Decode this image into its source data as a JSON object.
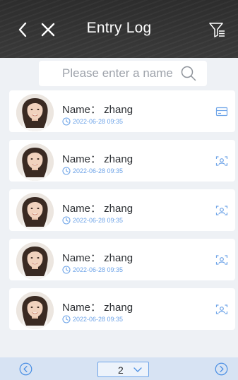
{
  "header": {
    "title": "Entry Log",
    "back_icon": "chevron-left-icon",
    "close_icon": "close-icon",
    "filter_icon": "filter-list-icon"
  },
  "search": {
    "placeholder": "Please enter a name",
    "value": "",
    "icon": "search-icon"
  },
  "entries": [
    {
      "name": "Name： zhang",
      "time": "2022-06-28 09:35",
      "method_icon": "card-icon"
    },
    {
      "name": "Name： zhang",
      "time": "2022-06-28 09:35",
      "method_icon": "face-scan-icon"
    },
    {
      "name": "Name： zhang",
      "time": "2022-06-28 09:35",
      "method_icon": "face-scan-icon"
    },
    {
      "name": "Name： zhang",
      "time": "2022-06-28 09:35",
      "method_icon": "face-scan-icon"
    },
    {
      "name": "Name： zhang",
      "time": "2022-06-28 09:35",
      "method_icon": "face-scan-icon"
    }
  ],
  "pagination": {
    "current_page": "2",
    "prev_icon": "circle-chevron-left-icon",
    "next_icon": "circle-chevron-right-icon"
  },
  "colors": {
    "header_bg": "#2d2d2d",
    "page_bg": "#eef1f5",
    "accent": "#6ea4e8",
    "footer_bg": "#d7e3f3"
  }
}
